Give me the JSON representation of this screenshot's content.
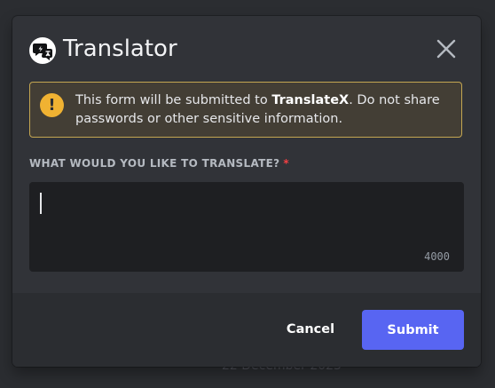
{
  "background": {
    "date_text": "22 December 2023"
  },
  "modal": {
    "title": "Translator",
    "app_icon": "translator-app-icon",
    "close_icon": "close-icon",
    "notice": {
      "icon": "exclamation-icon",
      "text_before": "This form will be submitted to ",
      "app_name": "TranslateX",
      "text_after": ". Do not share passwords or other sensitive information.",
      "border_color": "#c4a651",
      "icon_color": "#f0b232"
    },
    "field": {
      "label": "WHAT WOULD YOU LIKE TO TRANSLATE?",
      "required_marker": "*",
      "value": "",
      "char_limit": "4000"
    },
    "footer": {
      "cancel_label": "Cancel",
      "submit_label": "Submit",
      "submit_color": "#5865f2"
    }
  }
}
